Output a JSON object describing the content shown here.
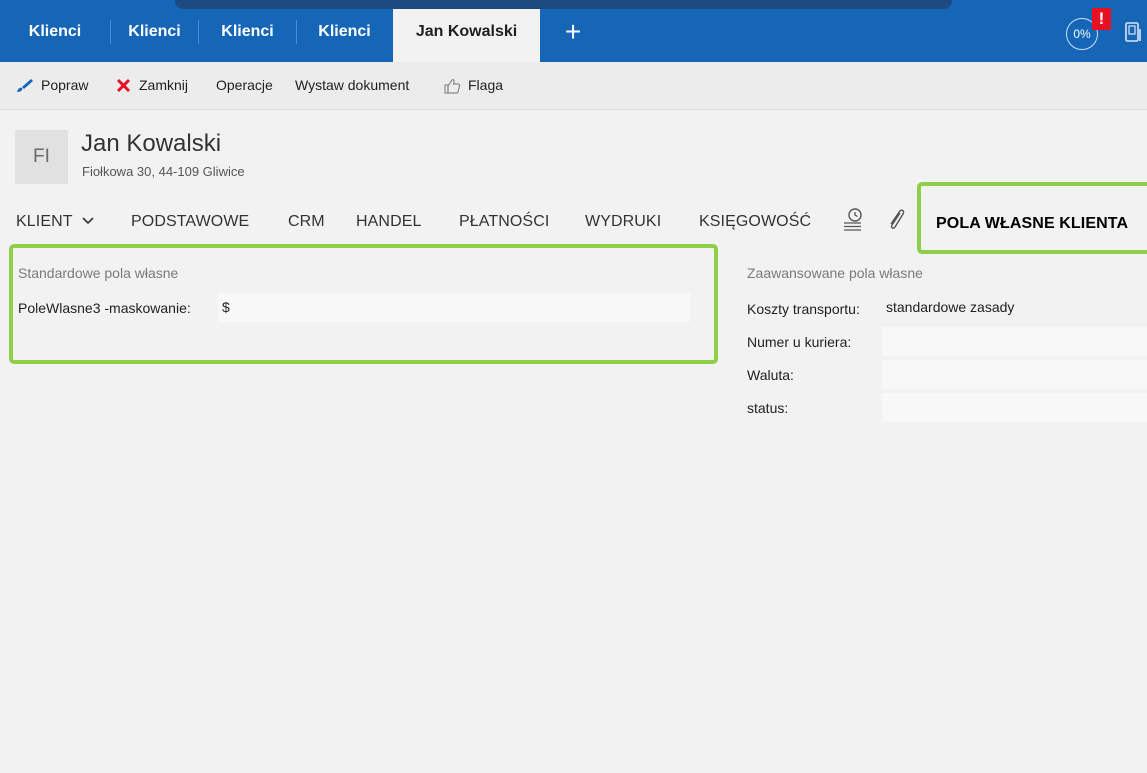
{
  "tabs": [
    {
      "label": "Klienci"
    },
    {
      "label": "Klienci"
    },
    {
      "label": "Klienci"
    },
    {
      "label": "Klienci"
    },
    {
      "label": "Jan Kowalski"
    }
  ],
  "status": {
    "progress": "0%",
    "alert_icon": "!"
  },
  "toolbar": {
    "edit_label": "Popraw",
    "close_label": "Zamknij",
    "operations_label": "Operacje",
    "issue_document_label": "Wystaw dokument",
    "flag_label": "Flaga"
  },
  "header": {
    "initials": "FI",
    "name": "Jan Kowalski",
    "address": "Fiołkowa 30, 44-109 Gliwice"
  },
  "nav": {
    "items": [
      "KLIENT",
      "PODSTAWOWE",
      "CRM",
      "HANDEL",
      "PŁATNOŚCI",
      "WYDRUKI",
      "KSIĘGOWOŚĆ"
    ],
    "active": "POLA WŁASNE KLIENTA"
  },
  "standard": {
    "title": "Standardowe pola własne",
    "field_label": "PoleWlasne3 -maskowanie:",
    "field_value": "$"
  },
  "advanced": {
    "title": "Zaawansowane pola własne",
    "fields": [
      {
        "label": "Koszty transportu:",
        "value": "standardowe zasady"
      },
      {
        "label": "Numer u kuriera:",
        "value": ""
      },
      {
        "label": "Waluta:",
        "value": ""
      },
      {
        "label": "status:",
        "value": ""
      }
    ]
  },
  "colors": {
    "accent": "#1666b8",
    "highlight": "#8ecf4a",
    "close_red": "#e81123",
    "brush_blue": "#1565c0"
  }
}
